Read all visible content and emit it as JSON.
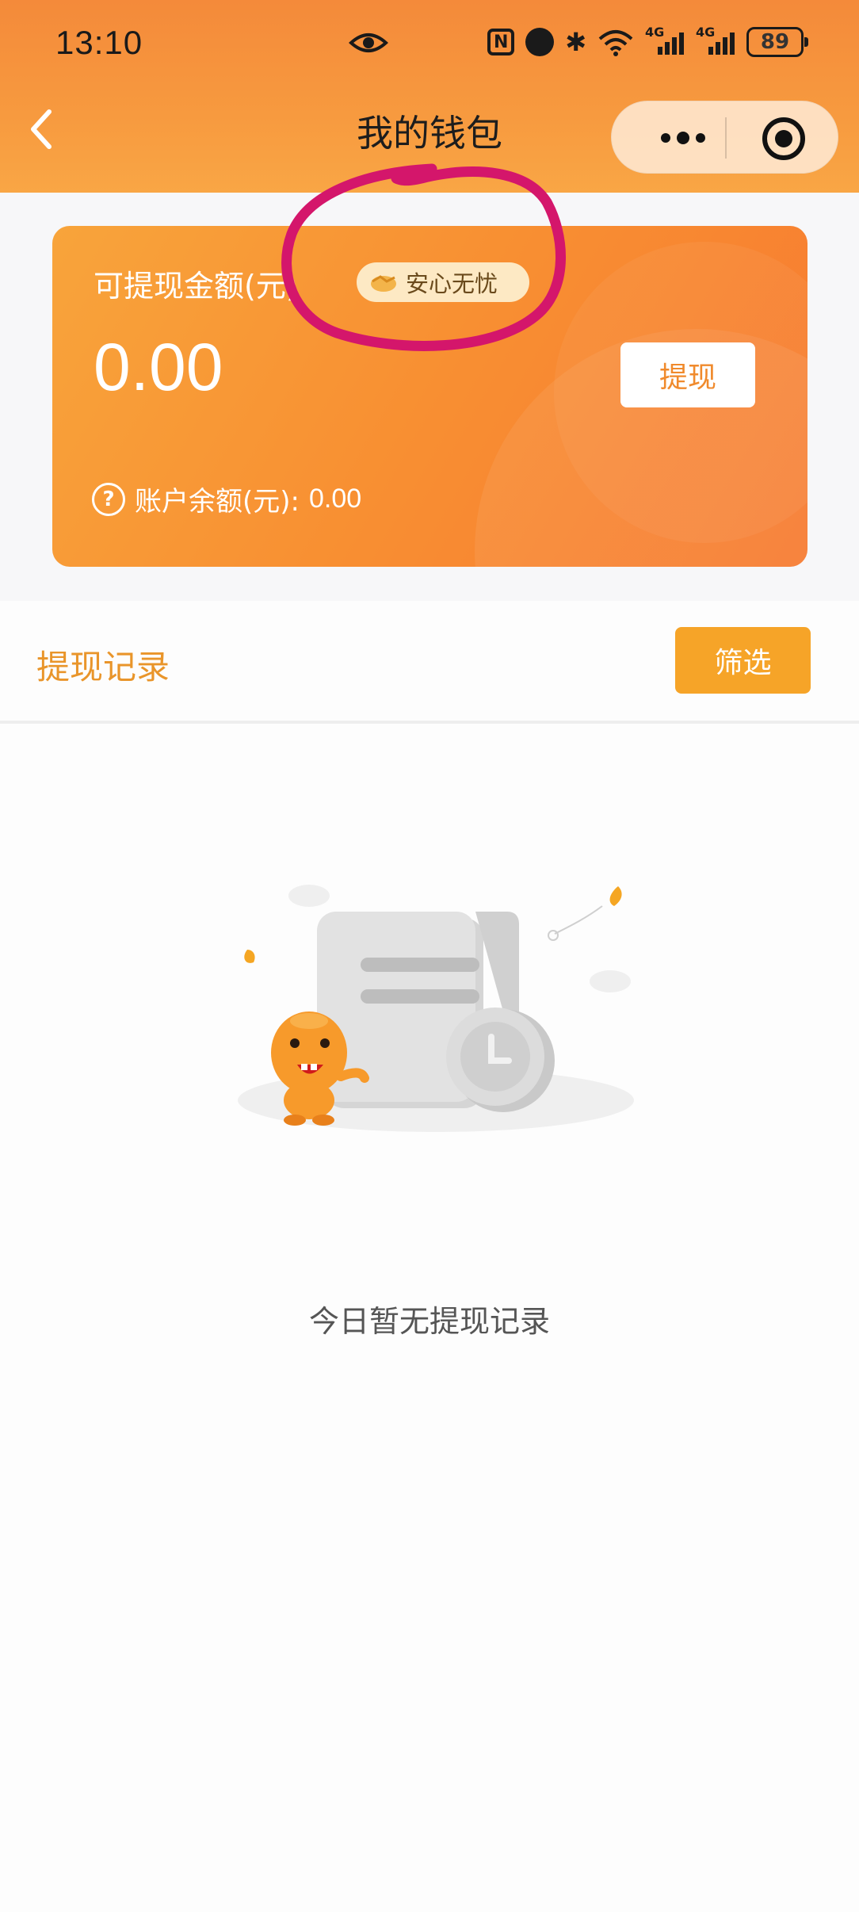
{
  "status_bar": {
    "time": "13:10",
    "nfc_label": "N",
    "signal_1_label": "4G",
    "signal_2_label": "4G",
    "battery": "89"
  },
  "nav": {
    "title": "我的钱包"
  },
  "wallet": {
    "withdrawable_label": "可提现金额(元)",
    "badge_label": "安心无忧",
    "withdrawable_amount": "0.00",
    "withdraw_button": "提现",
    "balance_label": "账户余额(元):",
    "balance_value": "0.00"
  },
  "records": {
    "title": "提现记录",
    "filter_button": "筛选",
    "empty_text": "今日暂无提现记录"
  },
  "colors": {
    "header_orange": "#f79a3f",
    "card_orange": "#f88f32",
    "records_title": "#e9952a",
    "filter_button": "#f6a428",
    "annotation": "#d4166b"
  }
}
